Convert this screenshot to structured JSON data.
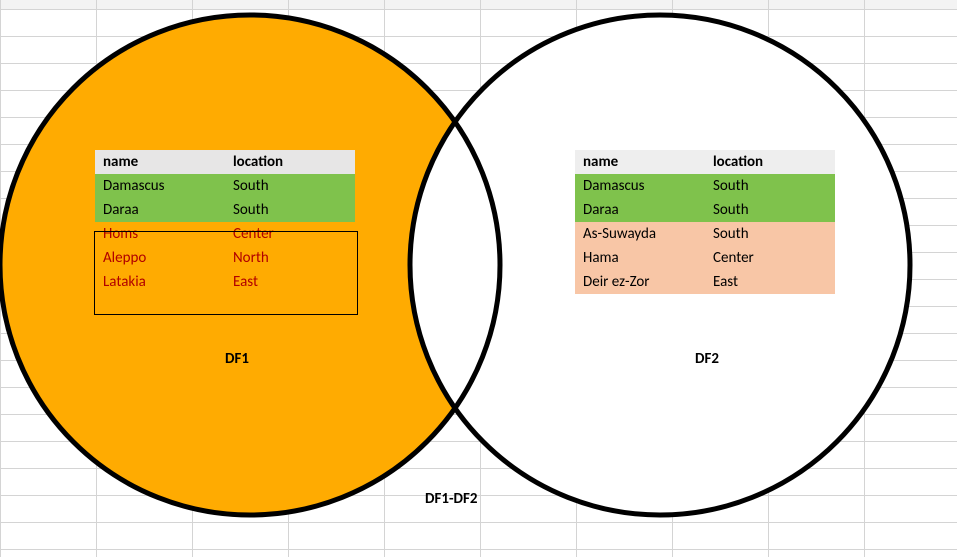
{
  "labels": {
    "df1": "DF1",
    "df2": "DF2",
    "diff": "DF1-DF2"
  },
  "columns": {
    "name": "name",
    "location": "location"
  },
  "df1": {
    "rows": [
      {
        "name": "Damascus",
        "location": "South",
        "cls": "green"
      },
      {
        "name": "Daraa",
        "location": "South",
        "cls": "green"
      },
      {
        "name": "Homs",
        "location": "Center",
        "cls": "orange"
      },
      {
        "name": "Aleppo",
        "location": "North",
        "cls": "orange"
      },
      {
        "name": "Latakia",
        "location": "East",
        "cls": "orange"
      }
    ]
  },
  "df2": {
    "rows": [
      {
        "name": "Damascus",
        "location": "South",
        "cls": "green"
      },
      {
        "name": "Daraa",
        "location": "South",
        "cls": "green"
      },
      {
        "name": "As-Suwayda",
        "location": "South",
        "cls": "peach"
      },
      {
        "name": "Hama",
        "location": "Center",
        "cls": "peach"
      },
      {
        "name": "Deir ez-Zor",
        "location": "East",
        "cls": "peach"
      }
    ]
  },
  "colors": {
    "left_fill": "#ffab01",
    "green": "#7fc24c",
    "orange": "#ffab01",
    "peach": "#f8c6a6",
    "stroke": "#000000"
  }
}
